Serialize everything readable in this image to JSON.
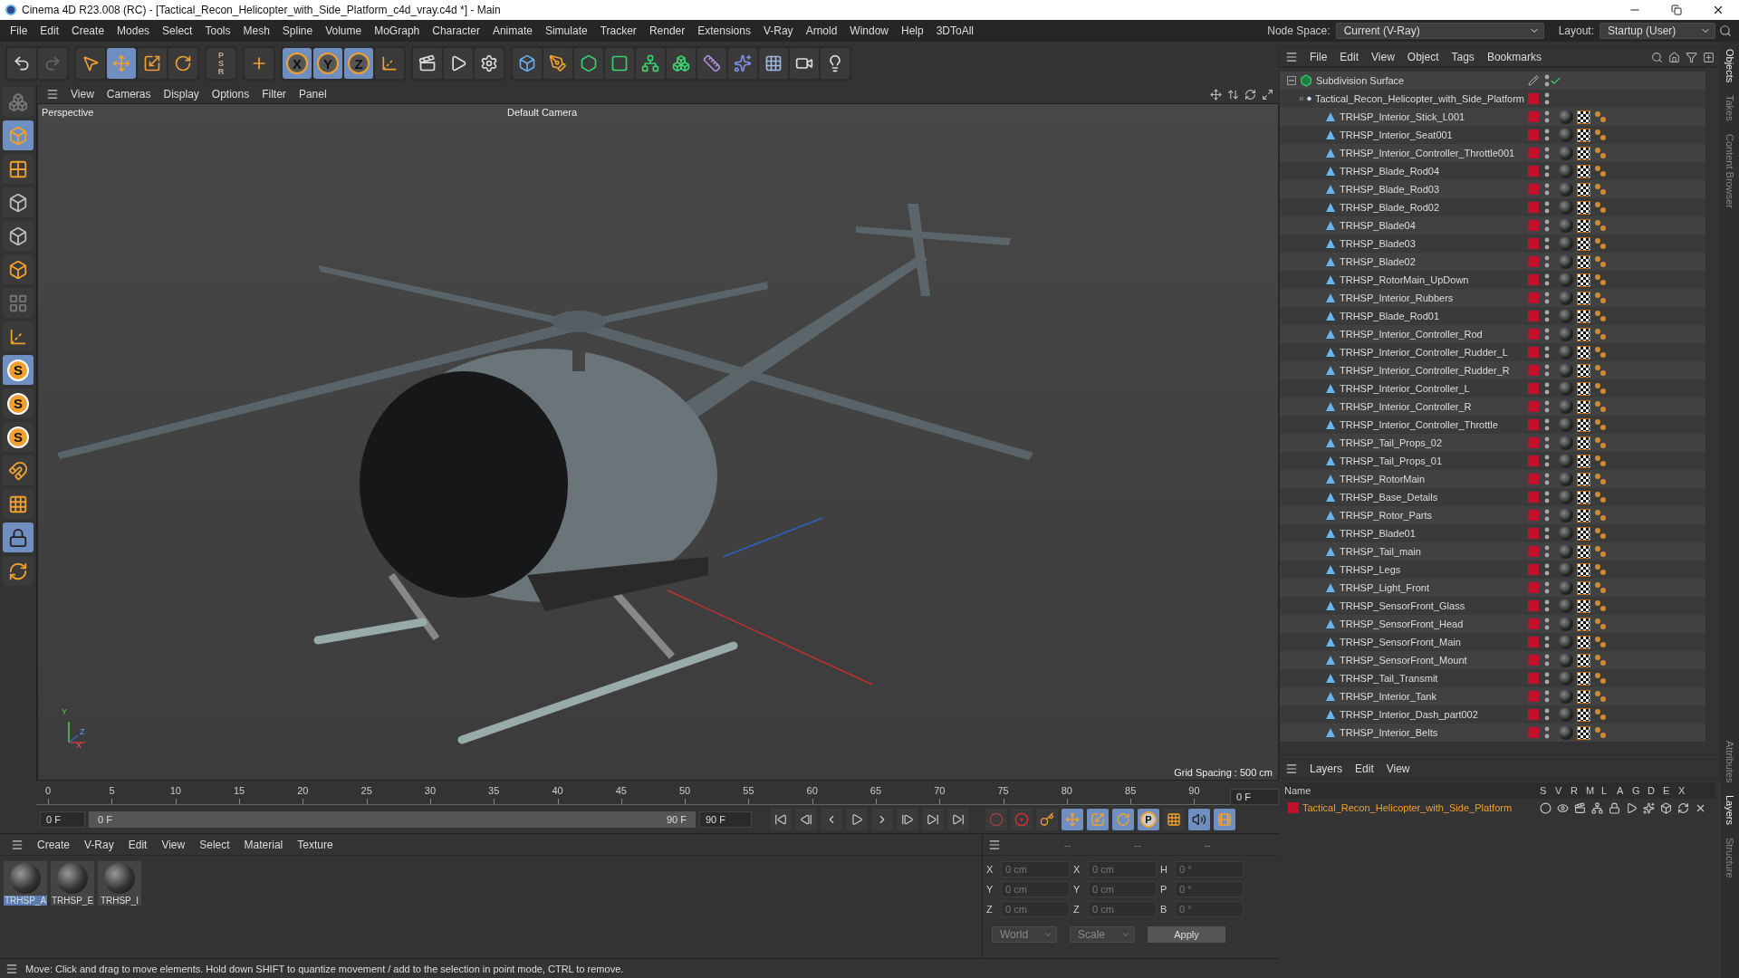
{
  "window": {
    "title": "Cinema 4D R23.008 (RC) - [Tactical_Recon_Helicopter_with_Side_Platform_c4d_vray.c4d *] - Main"
  },
  "menu_bar": [
    "File",
    "Edit",
    "Create",
    "Modes",
    "Select",
    "Tools",
    "Mesh",
    "Spline",
    "Volume",
    "MoGraph",
    "Character",
    "Animate",
    "Simulate",
    "Tracker",
    "Render",
    "Extensions",
    "V-Ray",
    "Arnold",
    "Window",
    "Help",
    "3DToAll"
  ],
  "node_space": {
    "label": "Node Space:",
    "value": "Current (V-Ray)"
  },
  "layout": {
    "label": "Layout:",
    "value": "Startup (User)"
  },
  "toolbar_groups": [
    {
      "items": [
        {
          "kind": "undo",
          "selected": false
        },
        {
          "kind": "redo",
          "selected": false
        }
      ]
    },
    {
      "items": [
        {
          "kind": "select",
          "selected": false
        },
        {
          "kind": "move",
          "selected": true
        },
        {
          "kind": "scale",
          "selected": false
        },
        {
          "kind": "rotate",
          "selected": false
        }
      ]
    },
    {
      "items": [
        {
          "kind": "psr",
          "label": "PSR",
          "selected": false
        }
      ]
    },
    {
      "items": [
        {
          "kind": "add",
          "selected": false
        }
      ]
    },
    {
      "items": [
        {
          "kind": "axis",
          "label": "X",
          "selected": true
        },
        {
          "kind": "axis",
          "label": "Y",
          "selected": true
        },
        {
          "kind": "axis",
          "label": "Z",
          "selected": true
        },
        {
          "kind": "coords",
          "selected": false
        }
      ]
    },
    {
      "items": [
        {
          "kind": "render-view",
          "selected": false
        },
        {
          "kind": "render",
          "selected": false
        },
        {
          "kind": "render-settings",
          "selected": false
        }
      ]
    },
    {
      "items": [
        {
          "kind": "cube",
          "selected": false
        },
        {
          "kind": "pen",
          "selected": false
        },
        {
          "kind": "subdivision",
          "selected": false
        },
        {
          "kind": "extrude",
          "selected": false
        },
        {
          "kind": "array",
          "selected": false
        },
        {
          "kind": "cloner",
          "selected": false
        },
        {
          "kind": "deformer",
          "selected": false
        },
        {
          "kind": "field",
          "selected": false
        },
        {
          "kind": "floor",
          "selected": false
        },
        {
          "kind": "camera",
          "selected": false
        },
        {
          "kind": "light",
          "selected": false
        }
      ]
    }
  ],
  "side_tools": [
    {
      "kind": "make-editable",
      "selected": false
    },
    {
      "kind": "model",
      "selected": true
    },
    {
      "kind": "texture",
      "selected": false
    },
    {
      "kind": "points",
      "selected": false
    },
    {
      "kind": "edges",
      "selected": false
    },
    {
      "kind": "polygons",
      "selected": false
    },
    {
      "kind": "uv",
      "selected": false
    },
    {
      "kind": "axis",
      "selected": false
    },
    {
      "kind": "snap",
      "label": "S",
      "selected": true
    },
    {
      "kind": "snap",
      "label": "S",
      "selected": false
    },
    {
      "kind": "snap",
      "label": "S",
      "selected": false
    },
    {
      "kind": "magnet",
      "selected": false
    },
    {
      "kind": "workplane",
      "selected": false
    },
    {
      "kind": "workplane-lock",
      "selected": true
    },
    {
      "kind": "workplane-align",
      "selected": false
    }
  ],
  "viewport": {
    "menu": [
      "View",
      "Cameras",
      "Display",
      "Options",
      "Filter",
      "Panel"
    ],
    "view_name": "Perspective",
    "camera": "Default Camera",
    "grid_spacing": "Grid Spacing : 500 cm",
    "gizmo_labels": [
      "Y",
      "Z",
      "X"
    ]
  },
  "timeline": {
    "ticks": [
      "0",
      "5",
      "10",
      "15",
      "20",
      "25",
      "30",
      "35",
      "40",
      "45",
      "50",
      "55",
      "60",
      "65",
      "70",
      "75",
      "80",
      "85",
      "90"
    ],
    "current_frame": "0 F",
    "start": "0 F",
    "range": {
      "start": "0 F",
      "end": "90 F",
      "level": 1
    },
    "end": "90 F",
    "transport": [
      {
        "kind": "first"
      },
      {
        "kind": "prev-key"
      },
      {
        "kind": "prev-frame"
      },
      {
        "kind": "play"
      },
      {
        "kind": "next-frame"
      },
      {
        "kind": "next-key"
      },
      {
        "kind": "last"
      },
      {
        "kind": "goto-end"
      }
    ],
    "record_tools": [
      {
        "kind": "auto-key",
        "selected": false
      },
      {
        "kind": "record",
        "selected": false
      },
      {
        "kind": "key",
        "selected": false
      },
      {
        "kind": "move",
        "selected": true
      },
      {
        "kind": "scale",
        "selected": true
      },
      {
        "kind": "rotate",
        "selected": true
      },
      {
        "kind": "param",
        "label": "P",
        "selected": true
      },
      {
        "kind": "pla",
        "selected": false
      },
      {
        "kind": "sound",
        "selected": true
      },
      {
        "kind": "film",
        "selected": true
      }
    ]
  },
  "materials": {
    "menu": [
      "Create",
      "V-Ray",
      "Edit",
      "View",
      "Select",
      "Material",
      "Texture"
    ],
    "items": [
      {
        "name": "TRHSP_A",
        "selected": true
      },
      {
        "name": "TRHSP_E",
        "selected": false
      },
      {
        "name": "TRHSP_I",
        "selected": false
      }
    ]
  },
  "coordinates": {
    "headers": [
      "--",
      "--",
      "--"
    ],
    "rows": [
      {
        "pos_axis": "X",
        "position": "0 cm",
        "size_axis": "X",
        "size": "0 cm",
        "rot_axis": "H",
        "rotation": "0 °"
      },
      {
        "pos_axis": "Y",
        "position": "0 cm",
        "size_axis": "Y",
        "size": "0 cm",
        "rot_axis": "P",
        "rotation": "0 °"
      },
      {
        "pos_axis": "Z",
        "position": "0 cm",
        "size_axis": "Z",
        "size": "0 cm",
        "rot_axis": "B",
        "rotation": "0 °"
      }
    ],
    "space": "World",
    "mode": "Scale",
    "apply": "Apply"
  },
  "status_bar": "Move: Click and drag to move elements. Hold down SHIFT to quantize movement / add to the selection in point mode, CTRL to remove.",
  "object_manager": {
    "menu": [
      "File",
      "Edit",
      "View",
      "Object",
      "Tags",
      "Bookmarks"
    ],
    "tree": [
      {
        "name": "Subdivision Surface",
        "kind": "subdivision",
        "expanded": true,
        "enabled": true,
        "children": [
          {
            "name": "Tactical_Recon_Helicopter_with_Side_Platform",
            "kind": "null",
            "expanded": true,
            "children": [
              {
                "name": "TRHSP_Interior_Stick_L001",
                "kind": "polygon"
              },
              {
                "name": "TRHSP_Interior_Seat001",
                "kind": "polygon"
              },
              {
                "name": "TRHSP_Interior_Controller_Throttle001",
                "kind": "polygon"
              },
              {
                "name": "TRHSP_Blade_Rod04",
                "kind": "polygon"
              },
              {
                "name": "TRHSP_Blade_Rod03",
                "kind": "polygon"
              },
              {
                "name": "TRHSP_Blade_Rod02",
                "kind": "polygon"
              },
              {
                "name": "TRHSP_Blade04",
                "kind": "polygon"
              },
              {
                "name": "TRHSP_Blade03",
                "kind": "polygon"
              },
              {
                "name": "TRHSP_Blade02",
                "kind": "polygon"
              },
              {
                "name": "TRHSP_RotorMain_UpDown",
                "kind": "polygon"
              },
              {
                "name": "TRHSP_Interior_Rubbers",
                "kind": "polygon"
              },
              {
                "name": "TRHSP_Blade_Rod01",
                "kind": "polygon"
              },
              {
                "name": "TRHSP_Interior_Controller_Rod",
                "kind": "polygon"
              },
              {
                "name": "TRHSP_Interior_Controller_Rudder_L",
                "kind": "polygon"
              },
              {
                "name": "TRHSP_Interior_Controller_Rudder_R",
                "kind": "polygon"
              },
              {
                "name": "TRHSP_Interior_Controller_L",
                "kind": "polygon"
              },
              {
                "name": "TRHSP_Interior_Controller_R",
                "kind": "polygon"
              },
              {
                "name": "TRHSP_Interior_Controller_Throttle",
                "kind": "polygon"
              },
              {
                "name": "TRHSP_Tail_Props_02",
                "kind": "polygon"
              },
              {
                "name": "TRHSP_Tail_Props_01",
                "kind": "polygon"
              },
              {
                "name": "TRHSP_RotorMain",
                "kind": "polygon"
              },
              {
                "name": "TRHSP_Base_Details",
                "kind": "polygon"
              },
              {
                "name": "TRHSP_Rotor_Parts",
                "kind": "polygon"
              },
              {
                "name": "TRHSP_Blade01",
                "kind": "polygon"
              },
              {
                "name": "TRHSP_Tail_main",
                "kind": "polygon"
              },
              {
                "name": "TRHSP_Legs",
                "kind": "polygon"
              },
              {
                "name": "TRHSP_Light_Front",
                "kind": "polygon"
              },
              {
                "name": "TRHSP_SensorFront_Glass",
                "kind": "polygon"
              },
              {
                "name": "TRHSP_SensorFront_Head",
                "kind": "polygon"
              },
              {
                "name": "TRHSP_SensorFront_Main",
                "kind": "polygon"
              },
              {
                "name": "TRHSP_SensorFront_Mount",
                "kind": "polygon"
              },
              {
                "name": "TRHSP_Tail_Transmit",
                "kind": "polygon"
              },
              {
                "name": "TRHSP_Interior_Tank",
                "kind": "polygon"
              },
              {
                "name": "TRHSP_Interior_Dash_part002",
                "kind": "polygon"
              },
              {
                "name": "TRHSP_Interior_Belts",
                "kind": "polygon"
              }
            ]
          }
        ]
      }
    ]
  },
  "layers": {
    "menu": [
      "Layers",
      "Edit",
      "View"
    ],
    "columns": [
      "Name",
      "S",
      "V",
      "R",
      "M",
      "L",
      "A",
      "G",
      "D",
      "E",
      "X"
    ],
    "rows": [
      {
        "name": "Tactical_Recon_Helicopter_with_Side_Platform",
        "color": "#c0102a"
      }
    ]
  },
  "side_tabs": [
    {
      "label": "Objects",
      "selected": true
    },
    {
      "label": "Takes",
      "selected": false
    },
    {
      "label": "Content Browser",
      "selected": false
    },
    {
      "label": "Attributes",
      "selected": false
    },
    {
      "label": "Layers",
      "selected": true
    },
    {
      "label": "Structure",
      "selected": false
    }
  ]
}
